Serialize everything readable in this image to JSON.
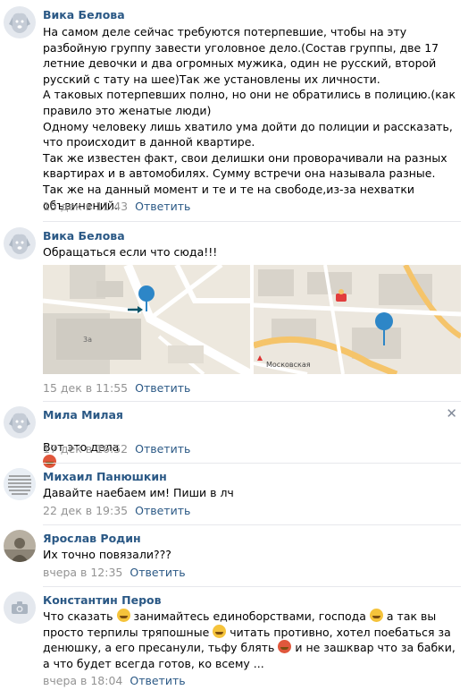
{
  "reply_label": "Ответить",
  "comments": [
    {
      "author": "Вика Белова",
      "text": "На самом деле сейчас требуются потерпевшие, чтобы на эту разбойную группу завести уголовное дело.(Состав группы, две 17 летние девочки и два огромных мужика, один не русский, второй русский с тату на шее)Так же установлены их личности.\nА таковых потерпевших полно, но они не обратились в полицию.(как правило это женатые люди)\nОдному человеку лишь хватило ума дойти до полиции и рассказать, что происходит в данной квартире.\nТак же известен факт, свои делишки они проворачивали на разных квартирах и в автомобилях. Сумму встречи она называла разные.\nТак же на данный момент и те и те на свободе,из-за нехватки объвинений.",
      "time": "15 дек в 11:43"
    },
    {
      "author": "Вика Белова",
      "text": "Обращаться если что сюда!!!",
      "time": "15 дек в 11:55",
      "map_labels": {
        "building": "3а",
        "station": "Московская"
      }
    },
    {
      "author": "Мила Милая",
      "text": "Вот это дела",
      "time": "17 дек в 16:52"
    },
    {
      "author": "Михаил Панюшкин",
      "text": "Давайте наебаем им! Пиши в лч",
      "time": "22 дек в 19:35"
    },
    {
      "author": "Ярослав Родин",
      "text": "Их точно повязали???",
      "time": "вчера в 12:35"
    },
    {
      "author": "Константин Перов",
      "text_parts": [
        "Что сказать",
        "занимайтесь единоборствами, господа",
        "а так вы просто терпилы тряпошные",
        "читать противно, хотел поебаться за денюшку, а его пресанули, тьфу блять",
        "и не зашквар что за бабки, а что будет всегда готов, ко всему ..."
      ],
      "time": "вчера в 18:04"
    }
  ],
  "colors": {
    "link": "#2a5885",
    "meta": "#939393",
    "divider": "#e7e8ec"
  }
}
